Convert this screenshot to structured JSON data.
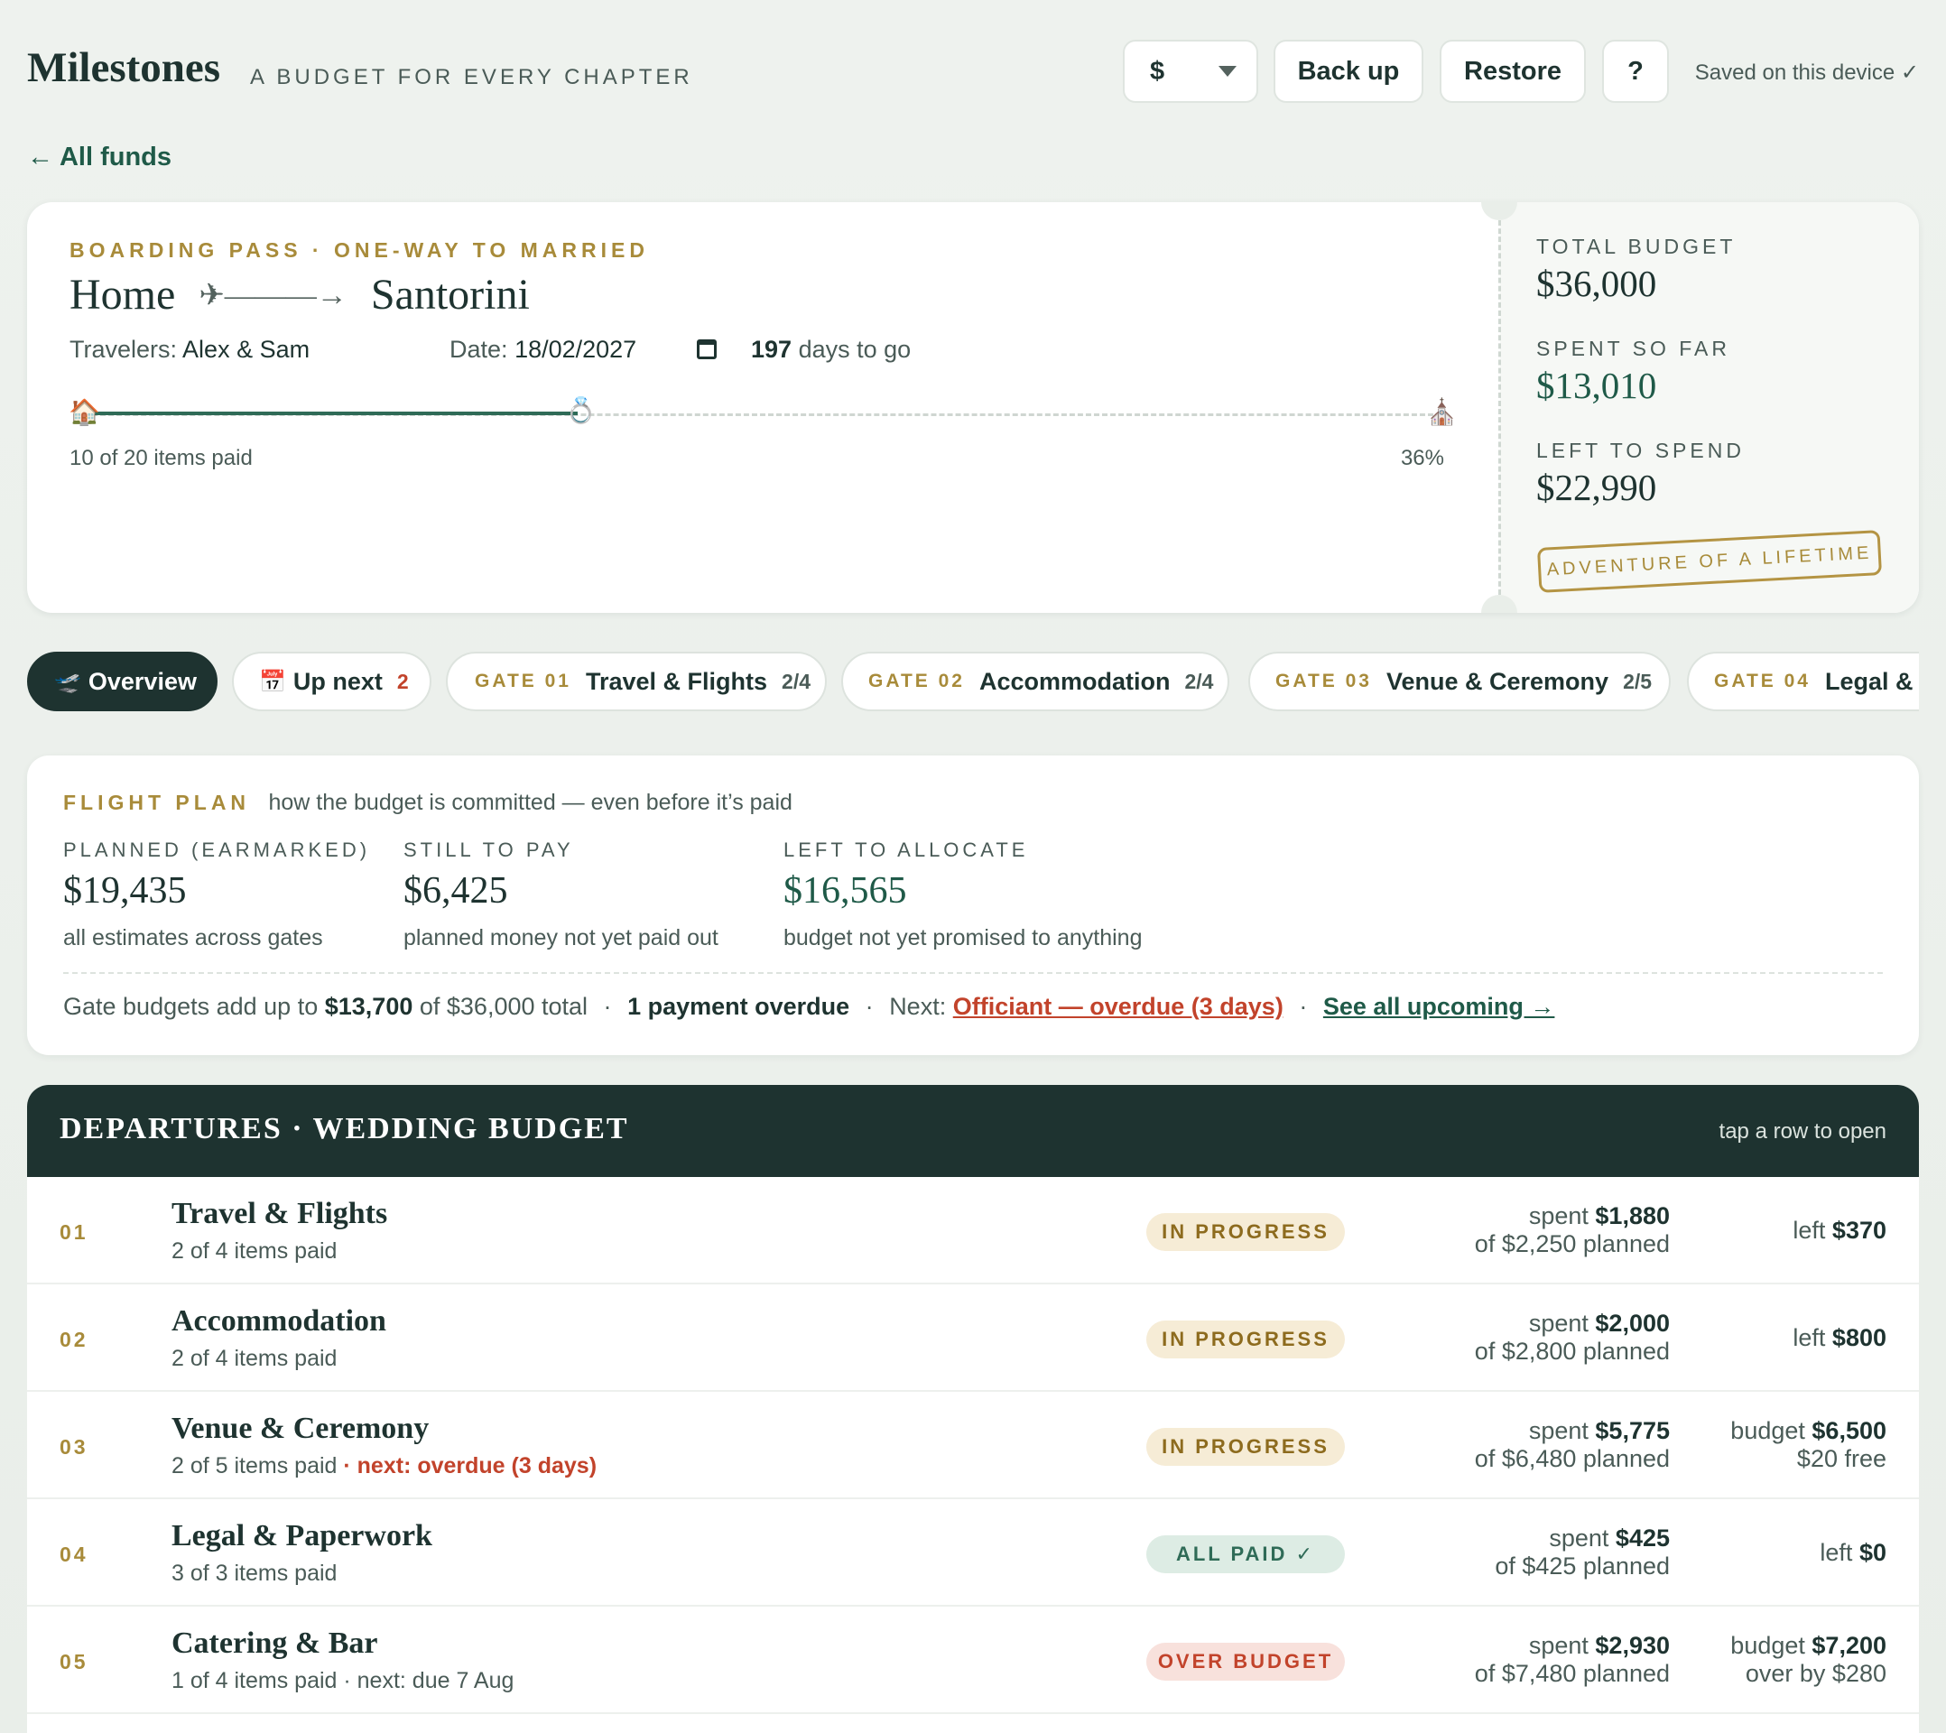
{
  "header": {
    "app_title": "Milestones",
    "tagline": "A BUDGET FOR EVERY CHAPTER",
    "currency": "$",
    "backup_label": "Back up",
    "restore_label": "Restore",
    "help_label": "?",
    "saved_status": "Saved on this device ✓"
  },
  "nav": {
    "back_link": "← All funds"
  },
  "pass": {
    "eyebrow": "BOARDING PASS · ONE-WAY TO MARRIED",
    "from": "Home",
    "arrow": "✈———→",
    "to": "Santorini",
    "travelers_label": "Travelers:",
    "travelers": "Alex & Sam",
    "date_label": "Date:",
    "date": "18/02/2027",
    "days_count": "197",
    "days_suffix": "days to go",
    "items_paid": "10 of 20 items paid",
    "progress_percent_label": "36%",
    "progress_fraction": 0.36,
    "start_icon": "🏠",
    "progress_icon": "💍",
    "end_icon": "⛪",
    "total_label": "TOTAL BUDGET",
    "total_value": "$36,000",
    "spent_label": "SPENT SO FAR",
    "spent_value": "$13,010",
    "left_label": "LEFT TO SPEND",
    "left_value": "$22,990",
    "stamp": "ADVENTURE OF A LIFETIME"
  },
  "tabs": [
    {
      "icon": "🛫",
      "label": "Overview",
      "gate": "",
      "count": ""
    },
    {
      "icon": "📅",
      "label": "Up next",
      "gate": "",
      "count": "2"
    },
    {
      "icon": "",
      "label": "Travel & Flights",
      "gate": "GATE 01",
      "count": "2/4"
    },
    {
      "icon": "",
      "label": "Accommodation",
      "gate": "GATE 02",
      "count": "2/4"
    },
    {
      "icon": "",
      "label": "Venue & Ceremony",
      "gate": "GATE 03",
      "count": "2/5"
    },
    {
      "icon": "",
      "label": "Legal & P",
      "gate": "GATE 04",
      "count": ""
    }
  ],
  "plan": {
    "eyebrow": "FLIGHT PLAN",
    "subtitle": "how the budget is committed — even before it’s paid",
    "planned_label": "PLANNED (EARMARKED)",
    "planned_value": "$19,435",
    "planned_note": "all estimates across gates",
    "still_label": "STILL TO PAY",
    "still_value": "$6,425",
    "still_note": "planned money not yet paid out",
    "alloc_label": "LEFT TO ALLOCATE",
    "alloc_value": "$16,565",
    "alloc_note": "budget not yet promised to anything",
    "foot_prefix": "Gate budgets add up to",
    "foot_gate_total": "$13,700",
    "foot_of": "of $36,000 total",
    "foot_sep": "·",
    "foot_overdue": "1 payment overdue",
    "foot_next_label": "Next:",
    "foot_next_link": "Officiant — overdue (3 days)",
    "foot_see_all": "See all upcoming →"
  },
  "departures": {
    "title": "DEPARTURES · WEDDING BUDGET",
    "hint": "tap a row to open",
    "rows": [
      {
        "num": "01",
        "name": "Travel & Flights",
        "sub": "2 of 4 items paid",
        "next": "",
        "status": "IN PROGRESS",
        "spent_label": "spent",
        "spent": "$1,880",
        "planned": "of $2,250 planned",
        "left_label": "left",
        "left": "$370",
        "left_note": ""
      },
      {
        "num": "02",
        "name": "Accommodation",
        "sub": "2 of 4 items paid",
        "next": "",
        "status": "IN PROGRESS",
        "spent_label": "spent",
        "spent": "$2,000",
        "planned": "of $2,800 planned",
        "left_label": "left",
        "left": "$800",
        "left_note": ""
      },
      {
        "num": "03",
        "name": "Venue & Ceremony",
        "sub": "2 of 5 items paid",
        "next": "· next: overdue (3 days)",
        "status": "IN PROGRESS",
        "spent_label": "spent",
        "spent": "$5,775",
        "planned": "of $6,480 planned",
        "left_label": "budget",
        "left": "$6,500",
        "left_note": "$20 free"
      },
      {
        "num": "04",
        "name": "Legal & Paperwork",
        "sub": "3 of 3 items paid",
        "next": "",
        "status": "ALL PAID ✓",
        "spent_label": "spent",
        "spent": "$425",
        "planned": "of $425 planned",
        "left_label": "left",
        "left": "$0",
        "left_note": ""
      },
      {
        "num": "05",
        "name": "Catering & Bar",
        "sub": "1 of 4 items paid · next: due 7 Aug",
        "next": "",
        "status": "OVER BUDGET",
        "spent_label": "spent",
        "spent": "$2,930",
        "planned": "of $7,480 planned",
        "left_label": "budget",
        "left": "$7,200",
        "left_note": "over by $280"
      }
    ]
  }
}
